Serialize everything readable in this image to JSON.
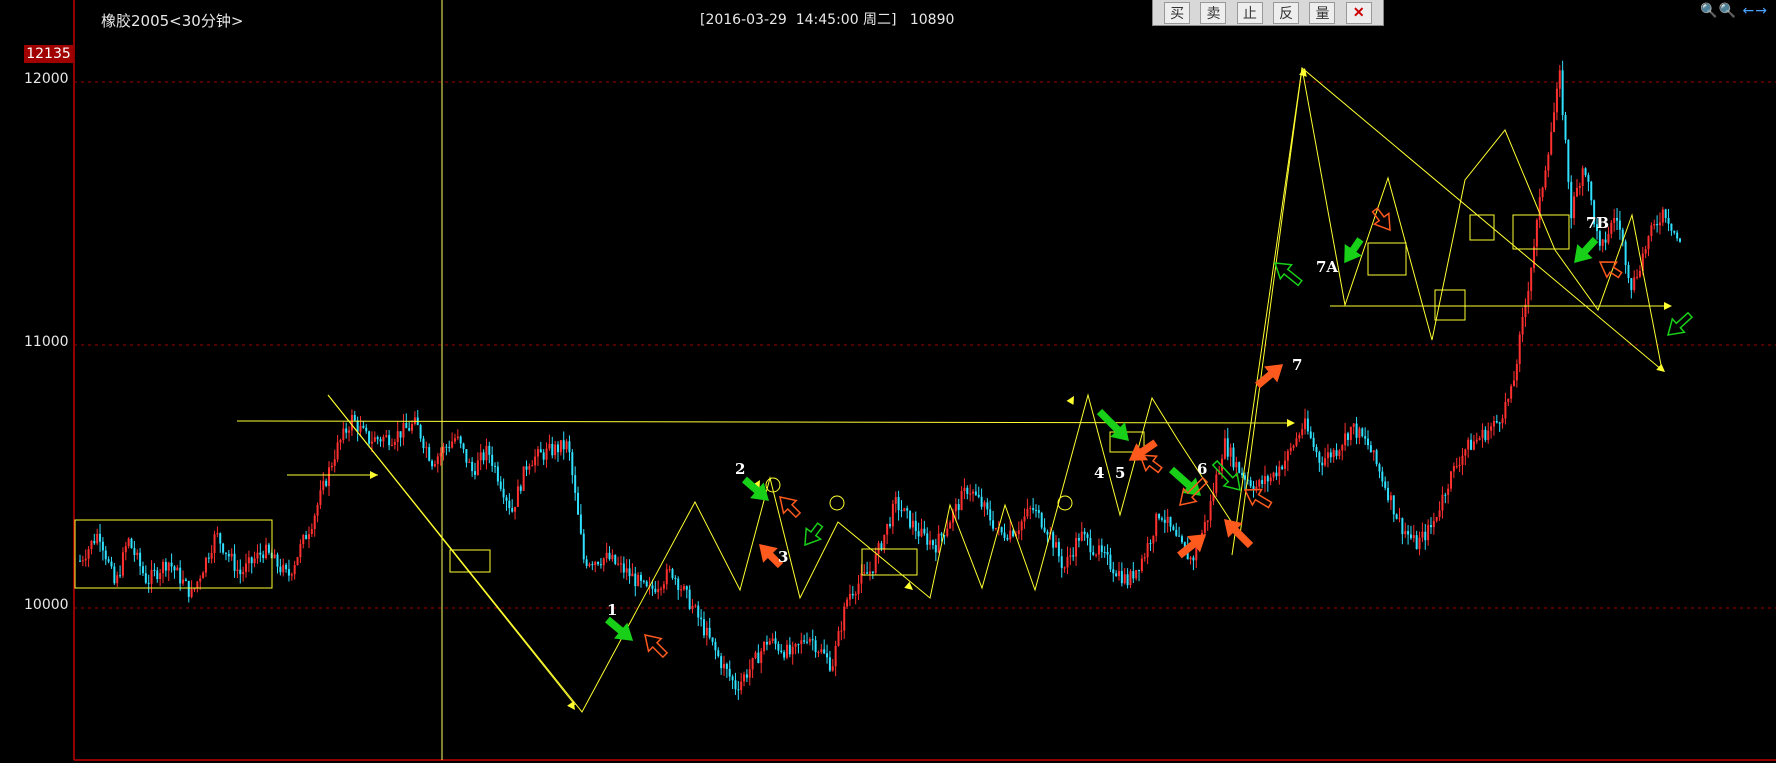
{
  "header": {
    "symbol": "橡胶2005<30分钟>",
    "cursor_info": "[2016-03-29  14:45:00 周二]   10890"
  },
  "toolbar": {
    "buttons": [
      "买",
      "卖",
      "止",
      "反",
      "量"
    ],
    "close_icon": "close-icon"
  },
  "zoom_controls": {
    "label": "🔍🔍 ←→"
  },
  "price_badge": "12135",
  "chart_data": {
    "type": "candlestick",
    "y_ticks": [
      "12000",
      "11000",
      "10000"
    ],
    "y_tick_values": [
      12000,
      11000,
      10000
    ],
    "ylim": [
      9400,
      12300
    ],
    "xlim": [
      0,
      100
    ],
    "grid": true,
    "colors": {
      "up": "#ff3030",
      "down": "#30e0ff",
      "annotation": "#ffff30",
      "buy_arrow": "#ff5a1e",
      "sell_arrow": "#18d018"
    },
    "price_path": [
      [
        0,
        10180
      ],
      [
        1.2,
        10290
      ],
      [
        2.2,
        10080
      ],
      [
        3,
        10260
      ],
      [
        4.2,
        10100
      ],
      [
        5.5,
        10180
      ],
      [
        7,
        10050
      ],
      [
        8.5,
        10280
      ],
      [
        10,
        10130
      ],
      [
        11.5,
        10220
      ],
      [
        13,
        10120
      ],
      [
        14.5,
        10330
      ],
      [
        16,
        10600
      ],
      [
        17,
        10720
      ],
      [
        18,
        10640
      ],
      [
        19.5,
        10650
      ],
      [
        21,
        10700
      ],
      [
        22,
        10560
      ],
      [
        23.5,
        10650
      ],
      [
        24.5,
        10520
      ],
      [
        25.5,
        10600
      ],
      [
        27,
        10370
      ],
      [
        28,
        10560
      ],
      [
        29.5,
        10600
      ],
      [
        30.5,
        10620
      ],
      [
        31.5,
        10180
      ],
      [
        33,
        10190
      ],
      [
        34.5,
        10120
      ],
      [
        35.5,
        10060
      ],
      [
        37,
        10140
      ],
      [
        38.5,
        9980
      ],
      [
        40,
        9800
      ],
      [
        41,
        9700
      ],
      [
        42,
        9780
      ],
      [
        43,
        9880
      ],
      [
        44.5,
        9820
      ],
      [
        45.5,
        9900
      ],
      [
        47,
        9780
      ],
      [
        48,
        10050
      ],
      [
        49.5,
        10150
      ],
      [
        51,
        10400
      ],
      [
        52.5,
        10280
      ],
      [
        53.5,
        10240
      ],
      [
        54.5,
        10350
      ],
      [
        55.5,
        10460
      ],
      [
        56.5,
        10380
      ],
      [
        57.5,
        10280
      ],
      [
        58.5,
        10300
      ],
      [
        59.5,
        10380
      ],
      [
        60.5,
        10300
      ],
      [
        61.5,
        10150
      ],
      [
        62.5,
        10280
      ],
      [
        63.5,
        10220
      ],
      [
        64.5,
        10160
      ],
      [
        65.5,
        10100
      ],
      [
        66.5,
        10200
      ],
      [
        67.5,
        10370
      ],
      [
        68.5,
        10260
      ],
      [
        69.5,
        10180
      ],
      [
        70.5,
        10350
      ],
      [
        71.5,
        10630
      ],
      [
        72.5,
        10520
      ],
      [
        73.5,
        10460
      ],
      [
        74.5,
        10500
      ],
      [
        75.5,
        10580
      ],
      [
        76.5,
        10700
      ],
      [
        77.5,
        10560
      ],
      [
        78.5,
        10600
      ],
      [
        79.5,
        10690
      ],
      [
        80.5,
        10620
      ],
      [
        81.5,
        10480
      ],
      [
        82.5,
        10320
      ],
      [
        83.5,
        10240
      ],
      [
        84.5,
        10310
      ],
      [
        85.5,
        10480
      ],
      [
        86.5,
        10600
      ],
      [
        87.5,
        10650
      ],
      [
        88.5,
        10700
      ],
      [
        89.5,
        10820
      ],
      [
        90.5,
        11220
      ],
      [
        91.5,
        11650
      ],
      [
        92.5,
        12020
      ],
      [
        93.2,
        11500
      ],
      [
        94,
        11700
      ],
      [
        95,
        11350
      ],
      [
        96,
        11500
      ],
      [
        97,
        11220
      ],
      [
        98,
        11400
      ],
      [
        99,
        11520
      ],
      [
        100,
        11380
      ]
    ],
    "annotations": [
      "1",
      "2",
      "3",
      "4",
      "5",
      "6",
      "7",
      "7A",
      "7B"
    ]
  }
}
